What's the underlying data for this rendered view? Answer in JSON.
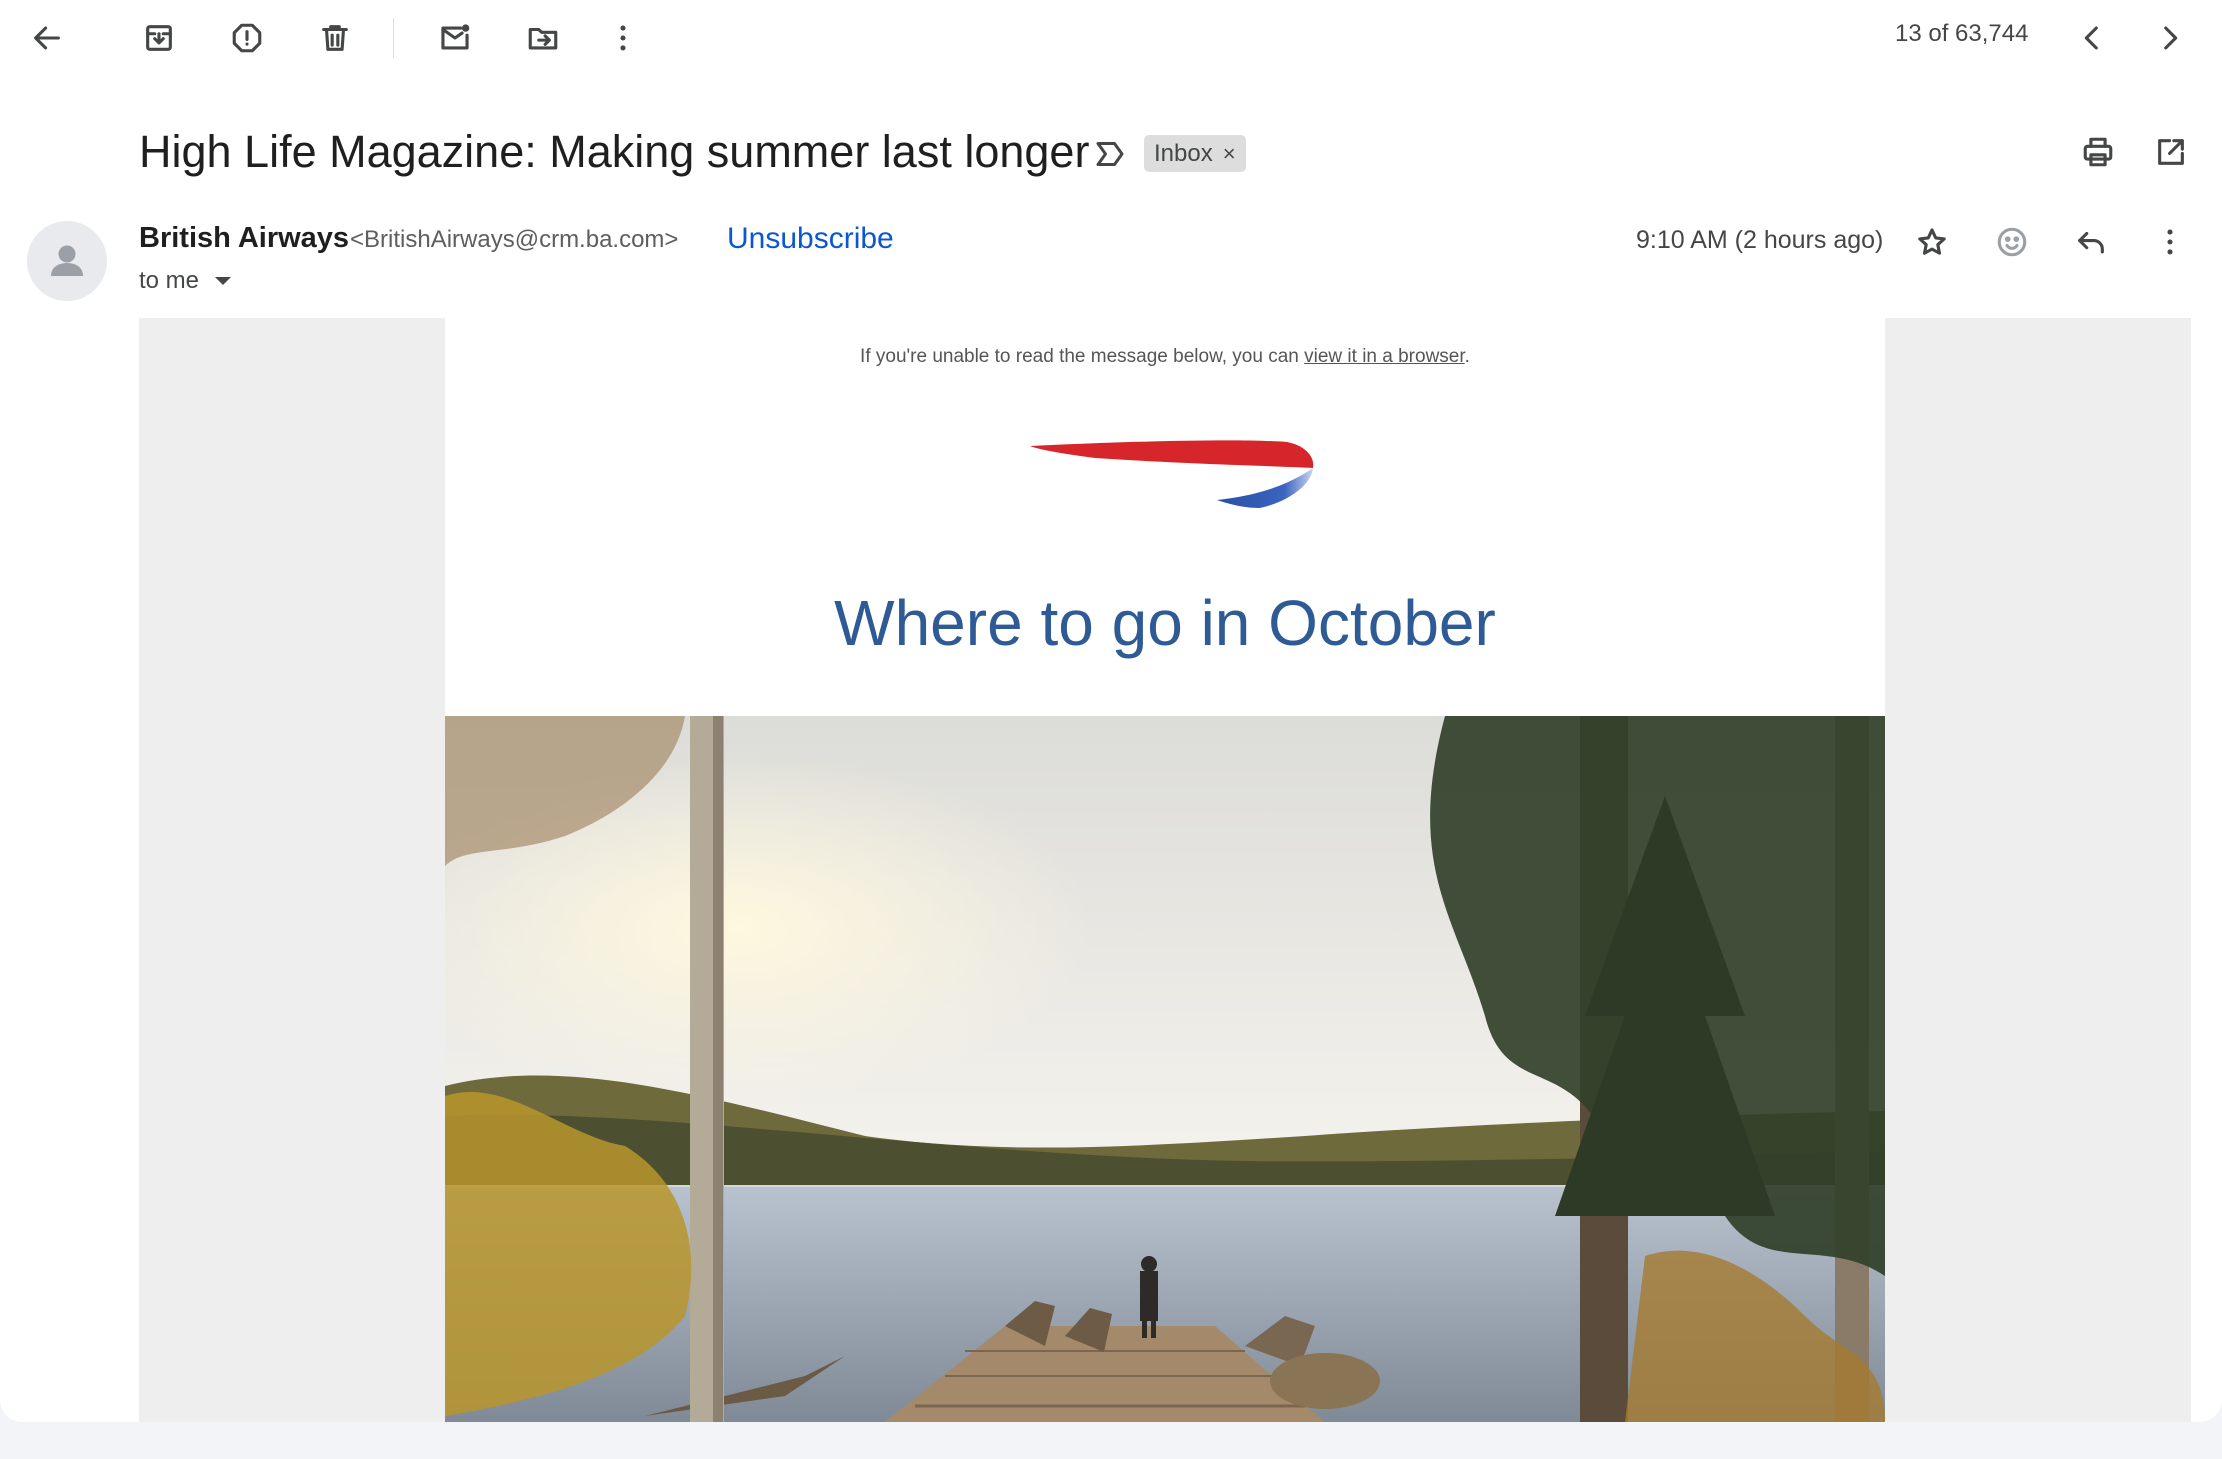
{
  "toolbar": {
    "back": "back-arrow-icon",
    "archive": "archive-icon",
    "spam": "report-spam-icon",
    "delete": "trash-icon",
    "unread": "mark-unread-icon",
    "move": "move-to-icon",
    "more": "more-vert-icon",
    "pager_text": "13 of 63,744",
    "prev": "chevron-left-icon",
    "next": "chevron-right-icon"
  },
  "subject": {
    "title": "High Life Magazine: Making summer last longer",
    "label_chip": "Inbox",
    "label_close": "×"
  },
  "header_actions": {
    "print": "print-icon",
    "open_new_window": "open-in-new-icon"
  },
  "message": {
    "sender_name": "British Airways",
    "sender_email": "<BritishAirways@crm.ba.com>",
    "unsubscribe": "Unsubscribe",
    "recipient": "to me",
    "time": "9:10 AM (2 hours ago)"
  },
  "body": {
    "preheader_text": "If you're unable to read the message below, you can ",
    "preheader_link": "view it in a browser",
    "preheader_end": ".",
    "headline": "Where to go in October"
  },
  "colors": {
    "link_blue": "#0b57d0",
    "headline_blue": "#2e5a95",
    "ba_red": "#d6262b",
    "ba_blue": "#2a4fa3"
  }
}
